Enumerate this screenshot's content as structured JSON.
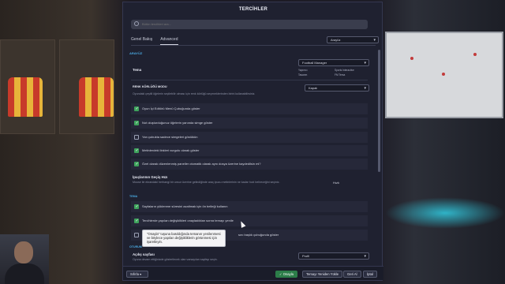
{
  "dialog": {
    "title": "TERCİHLER",
    "search_placeholder": "Bütün tercihleri ara...",
    "tabs": [
      "Genel Bakış",
      "Advanced"
    ],
    "view_dropdown": "Arayüz"
  },
  "interface": {
    "section_label": "ARAYÜZ",
    "theme_label": "Tema",
    "theme_value": "Football Manager",
    "theme_options": [
      "Yapımcı",
      "Sports Interactive",
      "Tasarım",
      "FM Tema"
    ],
    "colorblind_label": "RENK KÖRLÜĞÜ MODU",
    "colorblind_hint": "Oyundaki çeşitli öğelerin seçilebilir olması için renk körlüğü seçeneklerinden birini kullanabilirsiniz.",
    "colorblind_value": "Kapalı",
    "options": [
      {
        "label": "Oyun İçi Editörü Menü Çubuğunda göster",
        "checked": true
      },
      {
        "label": "Not oluşturduğunuz öğelerin yanında simge göster",
        "checked": true
      },
      {
        "label": "Yan çubukta sadece simgeleri göstükün",
        "checked": false
      },
      {
        "label": "Metinlerdeki linkleri vurgulu olarak göster",
        "checked": true
      },
      {
        "label": "Özel olarak düzenlenmiş paneller otomatik olarak aynı dosya üzerine kaydedilsin mi?",
        "checked": true
      }
    ],
    "transition_label": "İpuçlarının Geçiş Hızı",
    "transition_hint": "Mouse ile ekrandaki herhangi bir unsur üzerine gelindiğinde araç ipucu metinlerinin ne kadar hızlı belireceğini seçiniz.",
    "transition_value": "Hızlı"
  },
  "theme_section": {
    "section_label": "TEMA",
    "options": [
      {
        "label": "Sayfaların yüklenme süresini azaltmak için ön belleği kullanın",
        "checked": true
      },
      {
        "label": "Tercihlerde yapılan değişiklikleri onayladıktan sonra temayı yenile",
        "checked": true
      },
      {
        "label": "",
        "checked": false
      }
    ],
    "tooltip": "\"Onayla\" tuşuna basıldığında temanın yenilenmesi ve böylece yapılan değişikliklerin görünmesi için işaretleyin.",
    "trailing_text": "sını başlık çubuğunda göster"
  },
  "startup": {
    "section_label": "OTURUM",
    "label": "Açılış sayfası",
    "hint": "Oyuna devam ettiğinizde gösterilecek olan varsayılan sayfayı seçin.",
    "value": "Profil"
  },
  "footer": {
    "reset_label": "Sıfırla",
    "confirm_label": "Onayla",
    "reload_label": "Temayı Yeniden Yükle",
    "back_label": "Geri Al",
    "cancel_label": "İptal"
  }
}
